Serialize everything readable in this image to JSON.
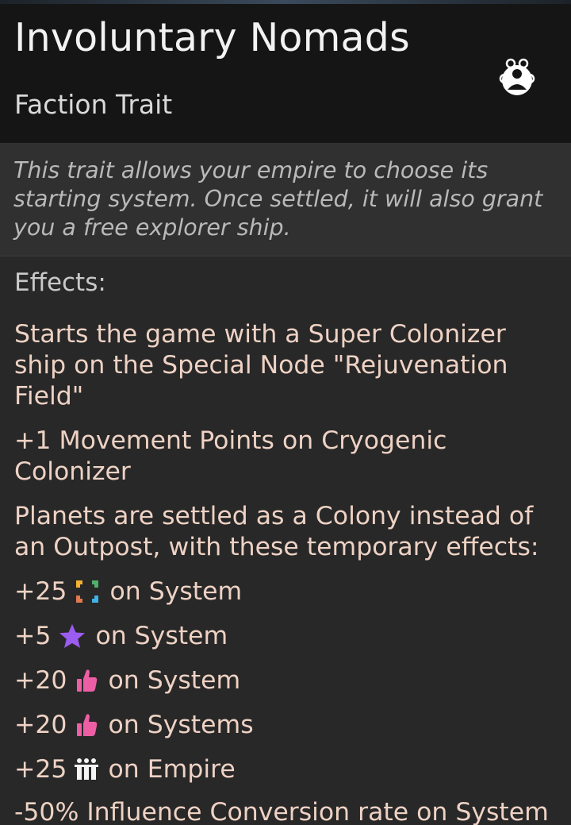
{
  "panel": {
    "title": "Involuntary Nomads",
    "subtitle": "Faction Trait",
    "faction_icon": "faction-population-icon",
    "description": "This trait allows your empire to choose its starting system. Once settled, it will also grant you a free explorer ship.",
    "effects_heading": "Effects:"
  },
  "effects": {
    "starts": "Starts the game with a Super Colonizer ship on the Special Node \"Rejuvenation Field\"",
    "movement": "+1 Movement Points on Cryogenic Colonizer",
    "planets": "Planets are settled as a Colony instead of an Outpost, with these temporary effects:",
    "rows": [
      {
        "value": "+25",
        "icon": "fids-icon",
        "target": "on System"
      },
      {
        "value": "+5",
        "icon": "star-icon",
        "target": "on System"
      },
      {
        "value": "+20",
        "icon": "thumbs-up-icon",
        "target": "on System"
      },
      {
        "value": "+20",
        "icon": "thumbs-up-icon",
        "target": "on Systems"
      },
      {
        "value": "+25",
        "icon": "population-icon",
        "target": "on Empire"
      }
    ],
    "last": "-50% Influence Conversion rate on System"
  },
  "colors": {
    "effect_text": "#eed2c4",
    "star": "#9b5cf0",
    "thumb": "#ec5fa5"
  }
}
